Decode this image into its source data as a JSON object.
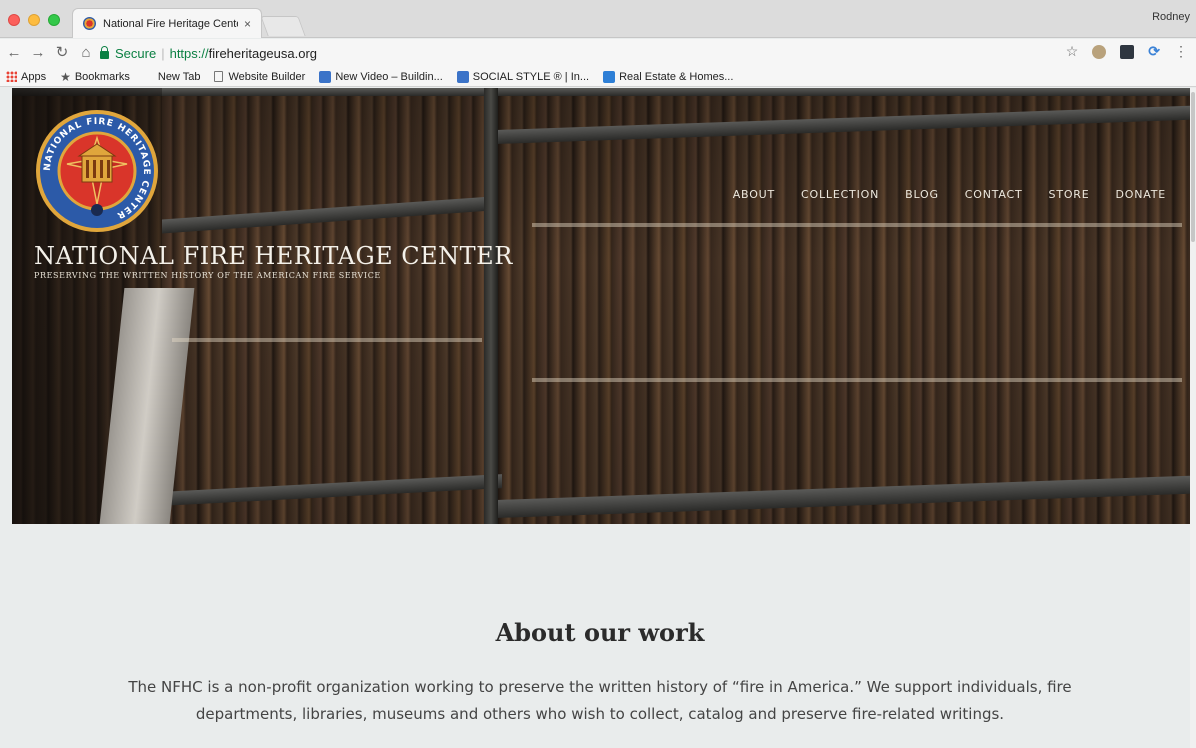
{
  "browser": {
    "tab_title": "National Fire Heritage Center",
    "tab_close": "×",
    "profile_name": "Rodney",
    "secure_label": "Secure",
    "url_scheme": "https://",
    "url_host": "fireheritageusa.org",
    "bookmarks": [
      {
        "label": "Apps",
        "icon": "apps-grid-icon"
      },
      {
        "label": "Bookmarks",
        "icon": "star-icon"
      },
      {
        "label": "New Tab",
        "icon": ""
      },
      {
        "label": "Website Builder",
        "icon": "page-icon"
      },
      {
        "label": "New Video – Buildin...",
        "icon": "site-icon"
      },
      {
        "label": "SOCIAL STYLE ® | In...",
        "icon": "site-icon"
      },
      {
        "label": "Real Estate & Homes...",
        "icon": "realestate-icon"
      }
    ]
  },
  "site": {
    "title": "NATIONAL FIRE HERITAGE CENTER",
    "tagline": "PRESERVING THE WRITTEN HISTORY OF THE AMERICAN FIRE SERVICE",
    "logo_ring_text": "NATIONAL FIRE HERITAGE CENTER",
    "nav": [
      "ABOUT",
      "COLLECTION",
      "BLOG",
      "CONTACT",
      "STORE",
      "DONATE"
    ]
  },
  "about": {
    "title": "About our work",
    "body": "The NFHC is a non-profit organization working to preserve the written history of “fire in America.” We support individuals, fire departments, libraries, museums and others who wish to collect, catalog and preserve fire-related writings."
  },
  "colors": {
    "accent_red": "#d9352a",
    "accent_gold": "#e8a63a",
    "accent_blue": "#2c5aa8",
    "secure_green": "#0b8043",
    "section_bg": "#e9ecec"
  }
}
